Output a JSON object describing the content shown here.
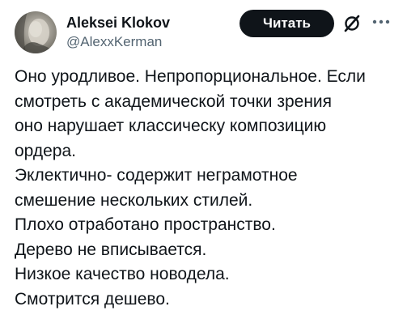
{
  "author": {
    "display_name": "Aleksei Klokov",
    "handle": "@AlexxKerman"
  },
  "actions": {
    "follow_label": "Читать",
    "grok_icon": "grok-slash-icon",
    "more_icon": "more-dots-icon"
  },
  "tweet": {
    "lines": [
      "Оно уродливое. Непропорциональное. Если",
      "смотреть с академической точки зрения",
      "оно нарушает классическу композицию",
      "ордера.",
      "Эклектично- содержит неграмотное",
      "смешение нескольких стилей.",
      "Плохо отработано пространство.",
      "Дерево не вписывается.",
      "Низкое качество новодела.",
      "Смотрится дешево."
    ]
  },
  "colors": {
    "text": "#0f1419",
    "secondary": "#536471",
    "button_bg": "#0f1419",
    "button_text": "#ffffff"
  }
}
